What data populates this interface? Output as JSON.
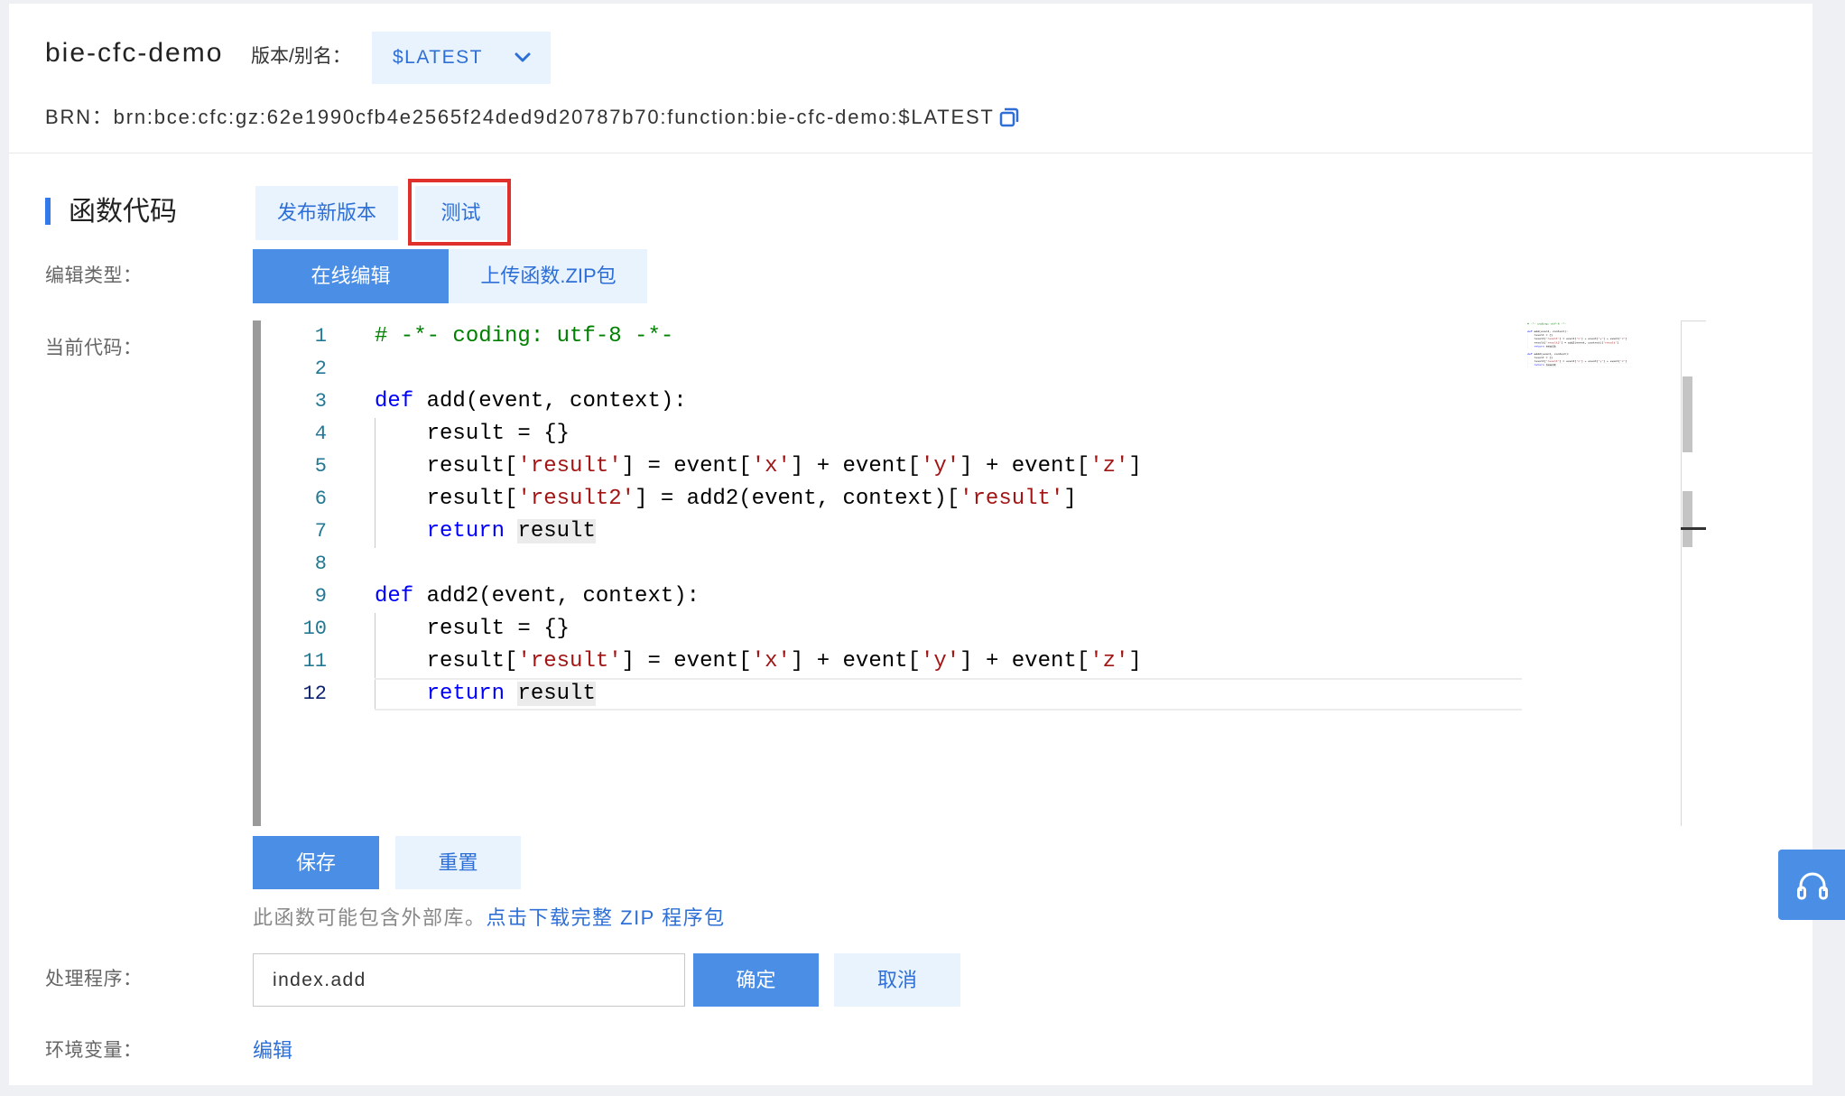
{
  "header": {
    "function_name": "bie-cfc-demo",
    "version_label": "版本/别名：",
    "version_selected": "$LATEST",
    "brn_label": "BRN：",
    "brn_value": "brn:bce:cfc:gz:62e1990cfb4e2565f24ded9d20787b70:function:bie-cfc-demo:$LATEST"
  },
  "code_section": {
    "title": "函数代码",
    "publish_button": "发布新版本",
    "test_button": "测试"
  },
  "edit_type": {
    "label": "编辑类型：",
    "options": [
      {
        "label": "在线编辑",
        "selected": true
      },
      {
        "label": "上传函数.ZIP包",
        "selected": false
      }
    ]
  },
  "code": {
    "label": "当前代码：",
    "lines": [
      {
        "number": "1",
        "tokens": [
          {
            "text": "# -*- coding: utf-8 -*-",
            "kind": "comment"
          }
        ]
      },
      {
        "number": "2",
        "tokens": []
      },
      {
        "number": "3",
        "tokens": [
          {
            "text": "def",
            "kind": "keyword"
          },
          {
            "text": " add(event, context):",
            "kind": "plain"
          }
        ]
      },
      {
        "number": "4",
        "tokens": [
          {
            "text": "    ",
            "kind": "indent"
          },
          {
            "text": "result = {}",
            "kind": "plain"
          }
        ]
      },
      {
        "number": "5",
        "tokens": [
          {
            "text": "    ",
            "kind": "indent"
          },
          {
            "text": "result[",
            "kind": "plain"
          },
          {
            "text": "'result'",
            "kind": "string"
          },
          {
            "text": "] = event[",
            "kind": "plain"
          },
          {
            "text": "'x'",
            "kind": "string"
          },
          {
            "text": "] + event[",
            "kind": "plain"
          },
          {
            "text": "'y'",
            "kind": "string"
          },
          {
            "text": "] + event[",
            "kind": "plain"
          },
          {
            "text": "'z'",
            "kind": "string"
          },
          {
            "text": "]",
            "kind": "plain"
          }
        ]
      },
      {
        "number": "6",
        "tokens": [
          {
            "text": "    ",
            "kind": "indent"
          },
          {
            "text": "result[",
            "kind": "plain"
          },
          {
            "text": "'result2'",
            "kind": "string"
          },
          {
            "text": "] = add2(event, context)[",
            "kind": "plain"
          },
          {
            "text": "'result'",
            "kind": "string"
          },
          {
            "text": "]",
            "kind": "plain"
          }
        ]
      },
      {
        "number": "7",
        "tokens": [
          {
            "text": "    ",
            "kind": "indent"
          },
          {
            "text": "return",
            "kind": "keyword"
          },
          {
            "text": " ",
            "kind": "plain"
          },
          {
            "text": "result",
            "kind": "occurrence"
          }
        ]
      },
      {
        "number": "8",
        "tokens": []
      },
      {
        "number": "9",
        "tokens": [
          {
            "text": "def",
            "kind": "keyword"
          },
          {
            "text": " add2(event, context):",
            "kind": "plain"
          }
        ]
      },
      {
        "number": "10",
        "tokens": [
          {
            "text": "    ",
            "kind": "indent"
          },
          {
            "text": "result = {}",
            "kind": "plain"
          }
        ]
      },
      {
        "number": "11",
        "tokens": [
          {
            "text": "    ",
            "kind": "indent"
          },
          {
            "text": "result[",
            "kind": "plain"
          },
          {
            "text": "'result'",
            "kind": "string"
          },
          {
            "text": "] = event[",
            "kind": "plain"
          },
          {
            "text": "'x'",
            "kind": "string"
          },
          {
            "text": "] + event[",
            "kind": "plain"
          },
          {
            "text": "'y'",
            "kind": "string"
          },
          {
            "text": "] + event[",
            "kind": "plain"
          },
          {
            "text": "'z'",
            "kind": "string"
          },
          {
            "text": "]",
            "kind": "plain"
          }
        ]
      },
      {
        "number": "12",
        "current": true,
        "tokens": [
          {
            "text": "    ",
            "kind": "indent"
          },
          {
            "text": "return",
            "kind": "keyword"
          },
          {
            "text": " ",
            "kind": "plain"
          },
          {
            "text": "result",
            "kind": "occurrence"
          }
        ]
      }
    ]
  },
  "code_actions": {
    "save_label": "保存",
    "reset_label": "重置"
  },
  "notice": {
    "text": "此函数可能包含外部库。",
    "link_text": "点击下载完整 ZIP 程序包"
  },
  "handler": {
    "label": "处理程序：",
    "value": "index.add",
    "confirm_label": "确定",
    "cancel_label": "取消"
  },
  "environment": {
    "label": "环境变量：",
    "edit_link": "编辑"
  },
  "icons": {
    "version_dropdown": "chevron-down-icon",
    "copy_brn": "copy-icon",
    "help": "headset-icon"
  },
  "colors": {
    "primary": "#4a8ee6",
    "primary_light": "#e9f3fd",
    "link": "#2d6fd6",
    "section_bar": "#3479ea",
    "test_highlight_border": "#e0302b",
    "page_background": "#eef0f4",
    "code_comment": "#008000",
    "code_keyword": "#0000ff",
    "code_string": "#a31515",
    "line_number": "#237893",
    "line_number_current": "#0b216f"
  }
}
